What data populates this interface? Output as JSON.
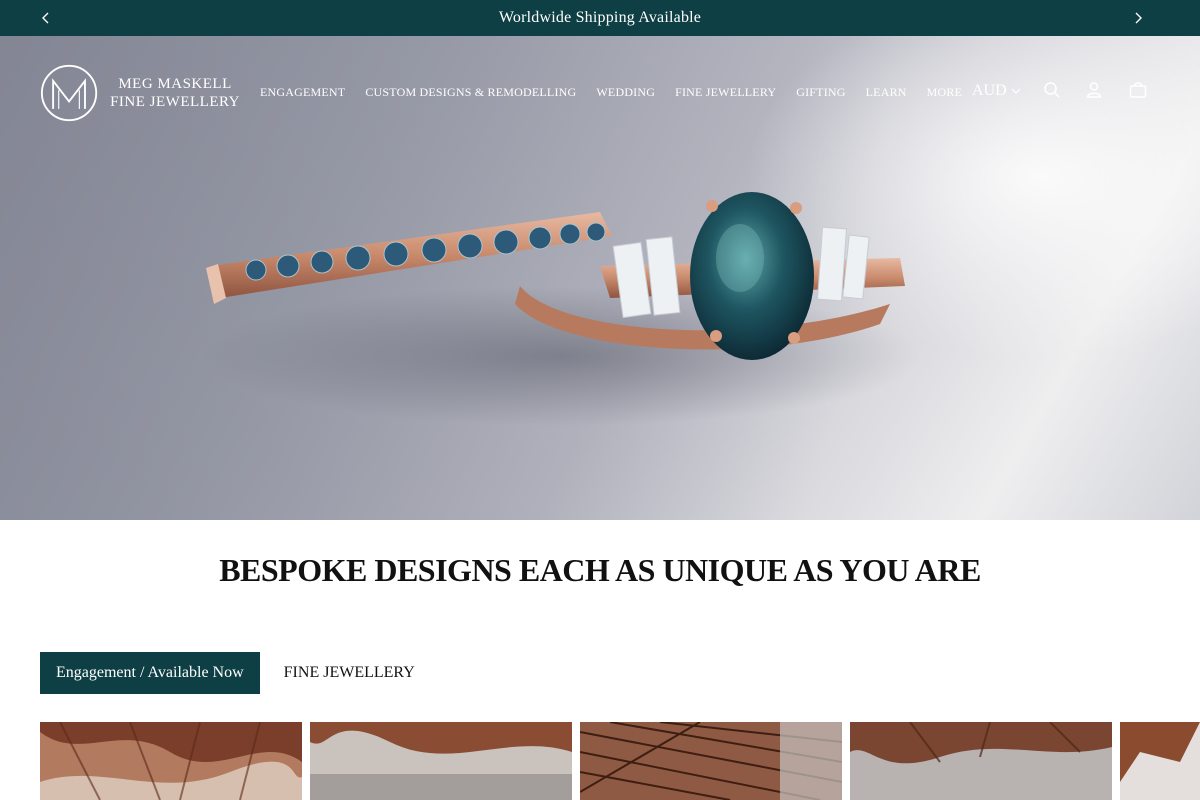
{
  "announcement": {
    "message": "Worldwide Shipping Available",
    "prev_icon": "chevron-left-icon",
    "next_icon": "chevron-right-icon"
  },
  "header": {
    "logo_line1": "MEG MASKELL",
    "logo_line2": "FINE JEWELLERY",
    "nav": [
      {
        "label": "ENGAGEMENT"
      },
      {
        "label": "CUSTOM DESIGNS & REMODELLING"
      },
      {
        "label": "WEDDING"
      },
      {
        "label": "FINE JEWELLERY"
      },
      {
        "label": "GIFTING"
      },
      {
        "label": "LEARN"
      },
      {
        "label": "MORE"
      }
    ],
    "currency": "AUD",
    "icons": [
      "search-icon",
      "account-icon",
      "cart-icon"
    ]
  },
  "section": {
    "title": "BESPOKE DESIGNS EACH AS UNIQUE AS YOU ARE",
    "tabs": [
      {
        "label": "Engagement / Available Now",
        "active": true
      },
      {
        "label": "FINE JEWELLERY",
        "active": false
      }
    ]
  },
  "colors": {
    "brand": "#0d3f45",
    "text": "#111111",
    "background": "#ffffff"
  }
}
